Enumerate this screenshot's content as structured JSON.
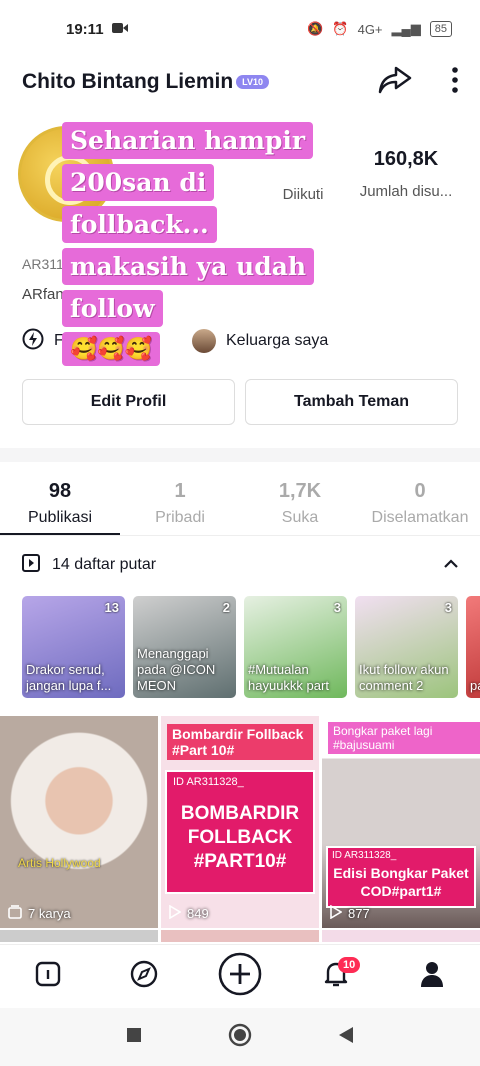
{
  "status_bar": {
    "time": "19:11",
    "battery": "85",
    "network": "4G+"
  },
  "profile": {
    "username": "Chito Bintang Liemin",
    "level": "LV10",
    "id_text": "AR311",
    "bio": "ARfan",
    "following_count": "",
    "following_label": "Diikuti",
    "likes_count": "160,8K",
    "likes_label": "Jumlah disu...",
    "quick_item": "F",
    "family_label": "Keluarga saya"
  },
  "overlay_text": {
    "lines": [
      "Seharian hampir",
      "200san di",
      "follback...",
      "makasih ya udah",
      "follow",
      "🥰🥰🥰"
    ]
  },
  "buttons": {
    "edit": "Edit Profil",
    "add_friend": "Tambah Teman"
  },
  "tabs": [
    {
      "count": "98",
      "label": "Publikasi"
    },
    {
      "count": "1",
      "label": "Pribadi"
    },
    {
      "count": "1,7K",
      "label": "Suka"
    },
    {
      "count": "0",
      "label": "Diselamatkan"
    }
  ],
  "playlist_section": {
    "label": "14 daftar putar"
  },
  "playlists": [
    {
      "count": "13",
      "caption": "Drakor serud, jangan lupa f...",
      "color": "#6e6bbf"
    },
    {
      "count": "2",
      "caption": "Menanggapi pada @ICON MEON",
      "color": "#7a8a8c"
    },
    {
      "count": "3",
      "caption": "#Mutualan hayuukkk part",
      "color": "#9fcf8f"
    },
    {
      "count": "3",
      "caption": "Ikut follow akun comment 2",
      "color": "#e4c6e4"
    },
    {
      "count": "",
      "caption": "pa",
      "color": "#e65a5a"
    }
  ],
  "videos": [
    {
      "meta": "7 karya",
      "overlay": "Artis Hollywood",
      "title": ""
    },
    {
      "meta": "849",
      "tag": "Bombardir Follback #Part 10#",
      "id": "ID AR311328_",
      "title": "BOMBARDIR FOLLBACK #PART10#"
    },
    {
      "meta": "877",
      "tag": "Bongkar paket lagi #bajusuami",
      "id": "ID AR311328_",
      "title": "Edisi Bongkar Paket COD#part1#"
    }
  ],
  "bottom_nav": {
    "notification_badge": "10"
  },
  "colors": {
    "accent": "#fe2c55",
    "overlay_pink": "#e66bd9",
    "lv_badge": "#8e86f0"
  }
}
